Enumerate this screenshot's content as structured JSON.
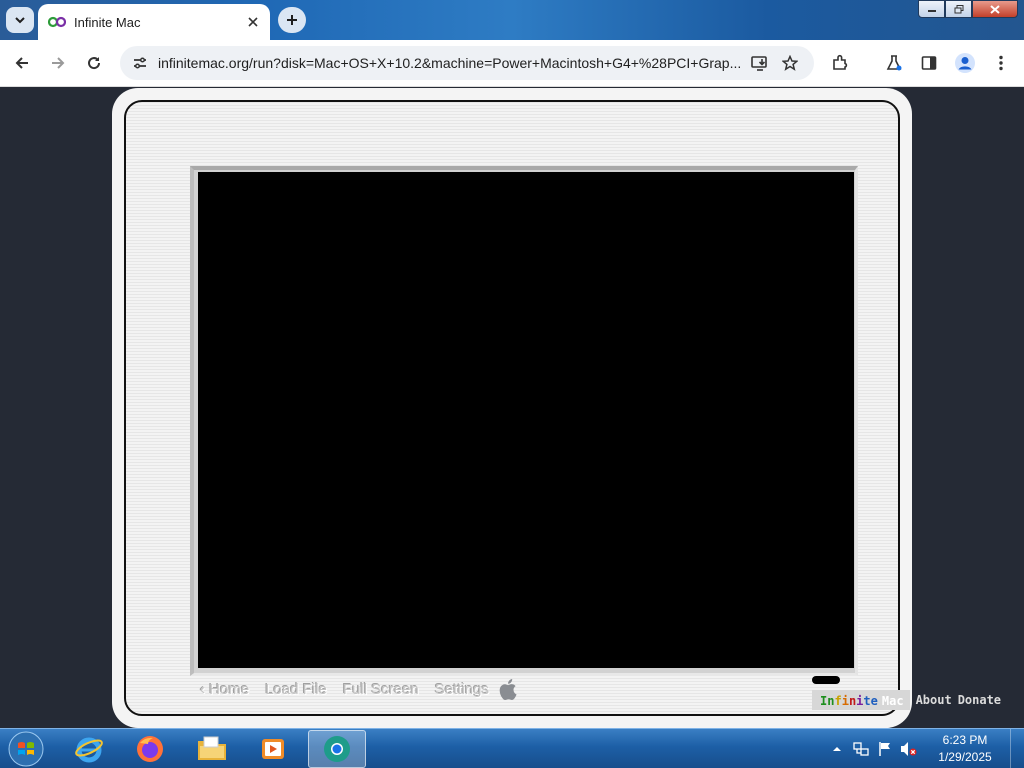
{
  "browser": {
    "tab": {
      "title": "Infinite Mac",
      "favicon": "infinite-loop-icon"
    },
    "address_bar": {
      "url": "infinitemac.org/run?disk=Mac+OS+X+10.2&machine=Power+Macintosh+G4+%28PCI+Grap..."
    },
    "icons": [
      "chevron-down-icon",
      "close-icon",
      "plus-icon",
      "back-arrow-icon",
      "forward-arrow-icon",
      "reload-icon",
      "site-info-icon",
      "install-app-icon",
      "star-icon",
      "extensions-icon",
      "labs-icon",
      "side-panel-icon",
      "profile-icon",
      "kebab-menu-icon"
    ]
  },
  "page": {
    "bezel_nav": {
      "home": "‹ Home",
      "load_file": "Load File",
      "full_screen": "Full Screen",
      "settings": "Settings"
    },
    "footer": {
      "brand": {
        "letters": [
          {
            "ch": "I",
            "color": "#1e8f1e"
          },
          {
            "ch": "n",
            "color": "#1e8f1e"
          },
          {
            "ch": "f",
            "color": "#c9a200"
          },
          {
            "ch": "i",
            "color": "#d76b00"
          },
          {
            "ch": "n",
            "color": "#c11b1b"
          },
          {
            "ch": "i",
            "color": "#7a1f9e"
          },
          {
            "ch": "t",
            "color": "#1f5fbf"
          },
          {
            "ch": "e",
            "color": "#1f5fbf"
          }
        ],
        "suffix": "Mac"
      },
      "about": "About",
      "donate": "Donate"
    },
    "colors": {
      "page_bg": "#252a35",
      "bezel": "#f4f4f4",
      "screen": "#000000"
    }
  },
  "taskbar": {
    "items": [
      "start-orb-icon",
      "internet-explorer-icon",
      "firefox-icon",
      "file-explorer-icon",
      "media-player-icon",
      "chrome-icon"
    ],
    "tray": [
      "show-hidden-icons-icon",
      "network-icon",
      "action-center-flag-icon",
      "volume-muted-icon"
    ],
    "clock": {
      "time": "6:23 PM",
      "date": "1/29/2025"
    }
  }
}
